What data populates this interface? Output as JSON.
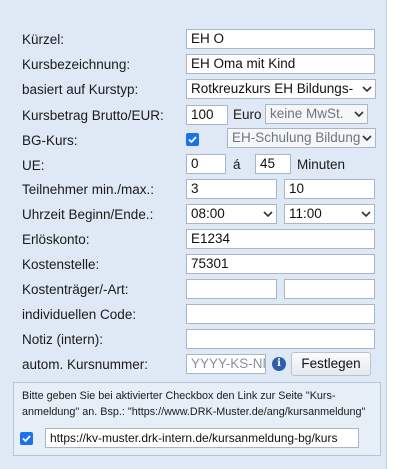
{
  "form": {
    "kuerzel": {
      "label": "Kürzel:",
      "value": "EH O"
    },
    "kursbezeichnung": {
      "label": "Kursbezeichnung:",
      "value": "EH Oma mit Kind"
    },
    "kurstyp": {
      "label": "basiert auf Kurstyp:",
      "value": "Rotkreuzkurs EH Bildungs-"
    },
    "kursbetrag": {
      "label": "Kursbetrag Brutto/EUR:",
      "value": "100",
      "currency": "Euro",
      "tax_select": "keine MwSt."
    },
    "bg_kurs": {
      "label": "BG-Kurs:",
      "checked": true,
      "select_value": "EH-Schulung Bildung"
    },
    "ue": {
      "label": "UE:",
      "count": "0",
      "times_symbol": "á",
      "minutes": "45",
      "minutes_label": "Minuten"
    },
    "teilnehmer": {
      "label": "Teilnehmer min./max.:",
      "min": "3",
      "max": "10"
    },
    "uhrzeit": {
      "label": "Uhrzeit Beginn/Ende.:",
      "start": "08:00",
      "end": "11:00"
    },
    "erloeskonto": {
      "label": "Erlöskonto:",
      "value": "E1234"
    },
    "kostenstelle": {
      "label": "Kostenstelle:",
      "value": "75301"
    },
    "kostentraeger": {
      "label": "Kostenträger/-Art:",
      "value1": "",
      "value2": ""
    },
    "individuellen_code": {
      "label": "individuellen Code:",
      "value": ""
    },
    "notiz": {
      "label": "Notiz (intern):",
      "value": ""
    },
    "kursnummer": {
      "label": "autom. Kursnummer:",
      "placeholder": "YYYY-KS-NN",
      "button": "Festlegen",
      "info_icon": "info-circle-icon"
    }
  },
  "anmeldung": {
    "hint_line1": "Bitte geben Sie bei aktivierter Checkbox den Link zur Seite \"Kurs-",
    "hint_line2": "anmeldung\" an. Bsp.: \"https://www.DRK-Muster.de/ang/kursanmeldung\"",
    "checked": true,
    "url": "https://kv-muster.drk-intern.de/kursanmeldung-bg/kurs"
  },
  "colors": {
    "panel": "#dfe9f6",
    "checkbox": "#1a73e8",
    "border": "#a9b6c6"
  }
}
